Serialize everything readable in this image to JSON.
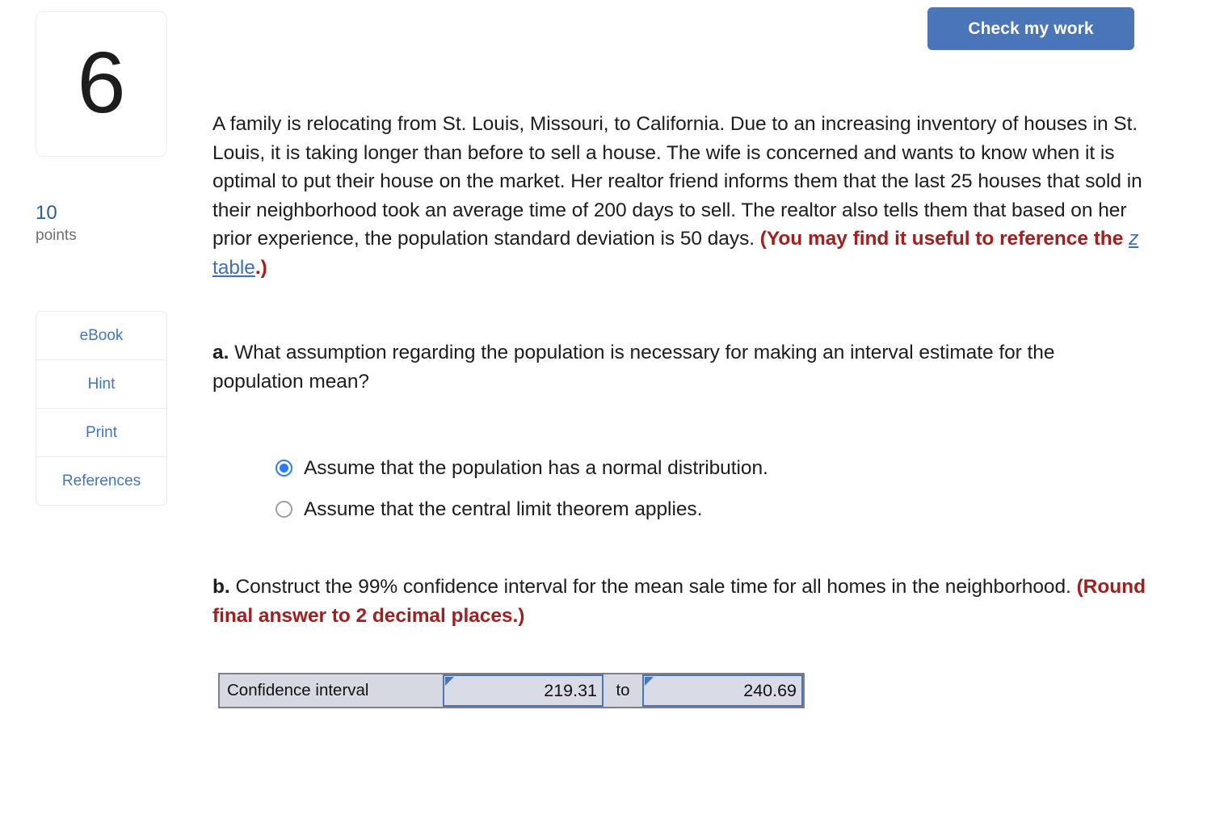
{
  "toolbar": {
    "check_my_work_label": "Check my work"
  },
  "sidebar": {
    "question_number": "6",
    "points_value": "10",
    "points_label": "points",
    "tools": [
      {
        "label": "eBook"
      },
      {
        "label": "Hint"
      },
      {
        "label": "Print"
      },
      {
        "label": "References"
      }
    ]
  },
  "question": {
    "body_part1": "A family is relocating from St. Louis, Missouri, to California. Due to an increasing inventory of houses in St. Louis, it is taking longer than before to sell a house. The wife is concerned and wants to know when it is optimal to put their house on the market. Her realtor friend informs them that the last 25 houses that sold in their neighborhood took an average time of 200 days to sell. The realtor also tells them that based on her prior experience, the population standard deviation is 50 days. ",
    "hint_prefix": "(You may find it useful to reference the ",
    "link_italic": "z",
    "link_rest": " table",
    "hint_suffix": ".)",
    "part_a": {
      "marker": "a.",
      "text": " What assumption regarding the population is necessary for making an interval estimate for the population mean?",
      "options": [
        {
          "label": "Assume that the population has a normal distribution.",
          "selected": true
        },
        {
          "label": "Assume that the central limit theorem applies.",
          "selected": false
        }
      ]
    },
    "part_b": {
      "marker": "b.",
      "text": " Construct the 99% confidence interval for the mean sale time for all homes in the neighborhood. ",
      "round_note": "(Round final answer to 2 decimal places.)",
      "answer": {
        "row_label": "Confidence interval",
        "lower_value": "219.31",
        "separator_label": "to",
        "upper_value": "240.69"
      }
    }
  },
  "colors": {
    "accent_blue": "#4a76b8",
    "link_blue": "#3c6fbe",
    "red_bold": "#a02020",
    "radio_blue": "#2a7cf7",
    "cell_fill": "#d9dce6"
  }
}
